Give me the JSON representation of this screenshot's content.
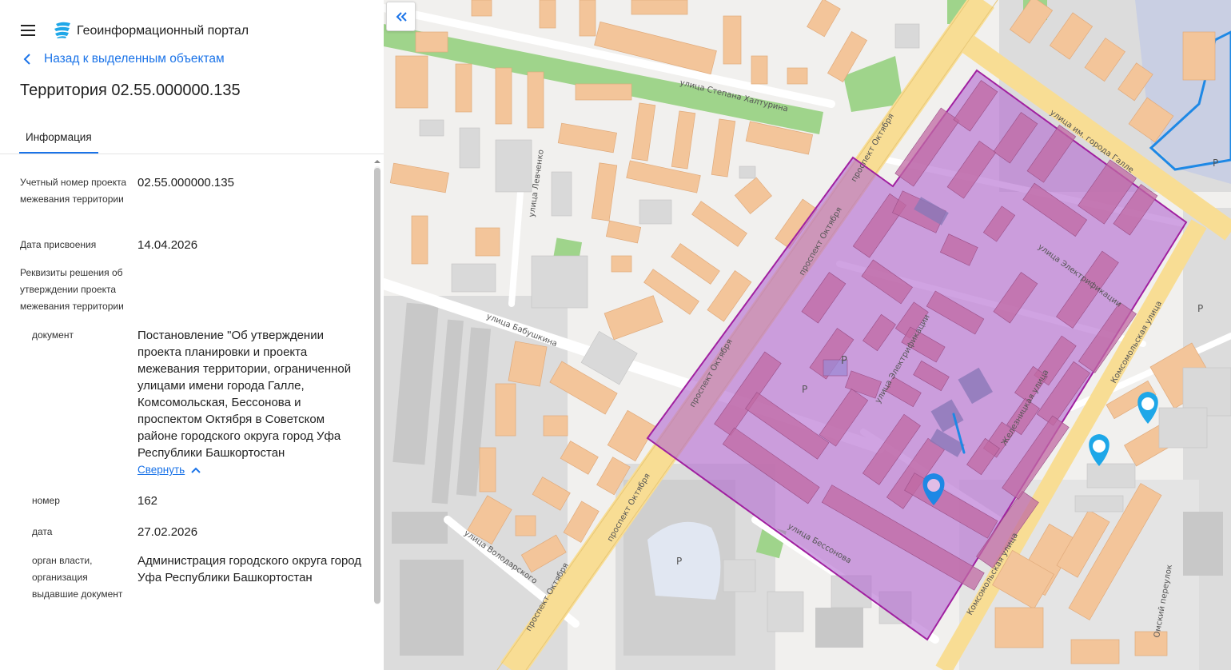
{
  "app": {
    "title": "Геоинформационный портал"
  },
  "nav": {
    "back_label": "Назад к выделенным объектам"
  },
  "page": {
    "title": "Территория 02.55.000000.135"
  },
  "tabs": [
    {
      "label": "Информация",
      "active": true
    }
  ],
  "fields": {
    "account_number": {
      "label": "Учетный номер проекта межевания территории",
      "value": "02.55.000000.135"
    },
    "assignment_date": {
      "label": "Дата присвоения",
      "value": "14.04.2026"
    },
    "decision_details": {
      "label": "Реквизиты решения об утверждении проекта межевания территории"
    },
    "document": {
      "label": "документ",
      "value": "Постановление \"Об утверждении проекта планировки и проекта межевания территории, ограниченной улицами имени города Галле, Комсомольская, Бессонова и проспектом Октября в Советском районе городского округа город Уфа Республики Башкортостан",
      "collapse_label": "Свернуть"
    },
    "number": {
      "label": "номер",
      "value": "162"
    },
    "date": {
      "label": "дата",
      "value": "27.02.2026"
    },
    "authority": {
      "label": "орган власти, организация выдавшие документ",
      "value": "Администрация городского округа город Уфа Республики Башкортостан"
    }
  },
  "colors": {
    "accent": "#1a73e8",
    "highlight_fill": "#b36bd1",
    "highlight_stroke": "#a020a0",
    "marker": "#1e88e5",
    "building": "#f3c59a",
    "road_main": "#f8dd94"
  },
  "map": {
    "streets": {
      "prospekt_oktyabrya": "проспект Октября",
      "galle": "улица им. города Галле",
      "khalturina": "улица Степана Халтурина",
      "elektrifikatsii": "улица Электрификации",
      "komsomolskaya": "Комсомольская улица",
      "bessonova": "улица Бессонова",
      "babushkina": "улица Бабушкина",
      "volodarskogo": "улица Володарского",
      "levchenko": "улица Левченко",
      "zheleznitskaya": "Железницкая улица",
      "omsky": "Омский переулок"
    },
    "parking_label": "P"
  }
}
